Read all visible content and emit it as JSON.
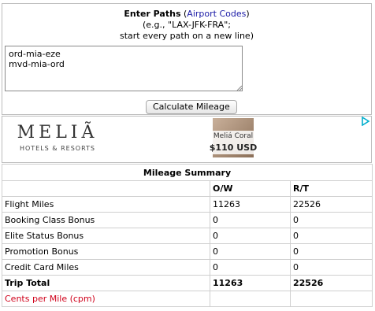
{
  "paths": {
    "title": "Enter Paths",
    "paren_open": "(",
    "link": "Airport Codes",
    "paren_close": ")",
    "example": "(e.g., \"LAX-JFK-FRA\";",
    "instruction": "start every path on a new line)",
    "input_value": "ord-mia-eze\nmvd-mia-ord",
    "button": "Calculate Mileage"
  },
  "ad": {
    "brand": "MELIÃ",
    "brand_sub": "HOTELS & RESORTS",
    "hotel": "Meliá Coral",
    "price": "$110 USD",
    "adchoice_color": "#00aecd"
  },
  "summary": {
    "title": "Mileage Summary",
    "columns": [
      "",
      "O/W",
      "R/T"
    ],
    "rows": [
      {
        "label": "Flight Miles",
        "ow": "11263",
        "rt": "22526"
      },
      {
        "label": "Booking Class Bonus",
        "ow": "0",
        "rt": "0"
      },
      {
        "label": "Elite Status Bonus",
        "ow": "0",
        "rt": "0"
      },
      {
        "label": "Promotion Bonus",
        "ow": "0",
        "rt": "0"
      },
      {
        "label": "Credit Card Miles",
        "ow": "0",
        "rt": "0"
      }
    ],
    "total": {
      "label": "Trip Total",
      "ow": "11263",
      "rt": "22526"
    },
    "cpm": {
      "label": "Cents per Mile (cpm)",
      "ow": "",
      "rt": ""
    }
  }
}
